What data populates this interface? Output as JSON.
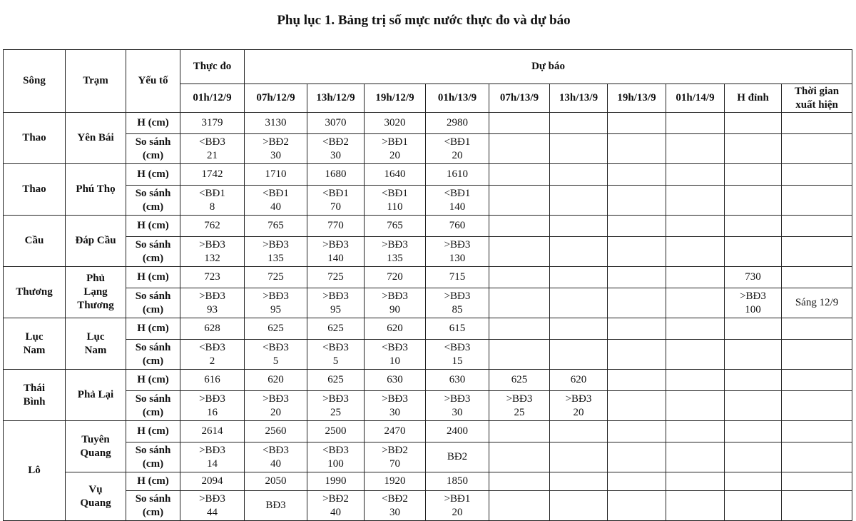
{
  "title": "Phụ lục 1. Bảng trị số mực nước thực đo và dự báo",
  "header": {
    "song": "Sông",
    "tram": "Trạm",
    "yeu_to": "Yếu tố",
    "thuc_do": "Thực đo",
    "du_bao": "Dự báo",
    "times": [
      "01h/12/9",
      "07h/12/9",
      "13h/12/9",
      "19h/12/9",
      "01h/13/9",
      "07h/13/9",
      "13h/13/9",
      "19h/13/9",
      "01h/14/9"
    ],
    "h_dinh": "H đỉnh",
    "thoi_gian": "Thời gian\nxuất hiện"
  },
  "labels": {
    "h": "H (cm)",
    "so_sanh": "So sánh\n(cm)"
  },
  "rows": [
    {
      "song": "Thao",
      "tram": "Yên Bái",
      "h": [
        "3179",
        "3130",
        "3070",
        "3020",
        "2980",
        "",
        "",
        "",
        ""
      ],
      "ss": [
        "<BĐ3\n21",
        ">BĐ2\n30",
        "<BĐ2\n30",
        ">BĐ1\n20",
        "<BĐ1\n20",
        "",
        "",
        "",
        ""
      ],
      "h_dinh": "",
      "ss_dinh": "",
      "thoi_gian": ""
    },
    {
      "song": "Thao",
      "tram": "Phú Thọ",
      "h": [
        "1742",
        "1710",
        "1680",
        "1640",
        "1610",
        "",
        "",
        "",
        ""
      ],
      "ss": [
        "<BĐ1\n8",
        "<BĐ1\n40",
        "<BĐ1\n70",
        "<BĐ1\n110",
        "<BĐ1\n140",
        "",
        "",
        "",
        ""
      ],
      "h_dinh": "",
      "ss_dinh": "",
      "thoi_gian": ""
    },
    {
      "song": "Cầu",
      "tram": "Đáp Cầu",
      "h": [
        "762",
        "765",
        "770",
        "765",
        "760",
        "",
        "",
        "",
        ""
      ],
      "ss": [
        ">BĐ3\n132",
        ">BĐ3\n135",
        ">BĐ3\n140",
        ">BĐ3\n135",
        ">BĐ3\n130",
        "",
        "",
        "",
        ""
      ],
      "h_dinh": "",
      "ss_dinh": "",
      "thoi_gian": ""
    },
    {
      "song": "Thương",
      "tram": "Phủ\nLạng\nThương",
      "h": [
        "723",
        "725",
        "725",
        "720",
        "715",
        "",
        "",
        "",
        ""
      ],
      "ss": [
        ">BĐ3\n93",
        ">BĐ3\n95",
        ">BĐ3\n95",
        ">BĐ3\n90",
        ">BĐ3\n85",
        "",
        "",
        "",
        ""
      ],
      "h_dinh": "730",
      "ss_dinh": ">BĐ3\n100",
      "thoi_gian": "Sáng 12/9"
    },
    {
      "song": "Lục\nNam",
      "tram": "Lục\nNam",
      "h": [
        "628",
        "625",
        "625",
        "620",
        "615",
        "",
        "",
        "",
        ""
      ],
      "ss": [
        "<BĐ3\n2",
        "<BĐ3\n5",
        "<BĐ3\n5",
        "<BĐ3\n10",
        "<BĐ3\n15",
        "",
        "",
        "",
        ""
      ],
      "h_dinh": "",
      "ss_dinh": "",
      "thoi_gian": ""
    },
    {
      "song": "Thái\nBình",
      "tram": "Phả Lại",
      "h": [
        "616",
        "620",
        "625",
        "630",
        "630",
        "625",
        "620",
        "",
        ""
      ],
      "ss": [
        ">BĐ3\n16",
        ">BĐ3\n20",
        ">BĐ3\n25",
        ">BĐ3\n30",
        ">BĐ3\n30",
        ">BĐ3\n25",
        ">BĐ3\n20",
        "",
        ""
      ],
      "h_dinh": "",
      "ss_dinh": "",
      "thoi_gian": ""
    },
    {
      "song": "Lô",
      "tram": "Tuyên\nQuang",
      "h": [
        "2614",
        "2560",
        "2500",
        "2470",
        "2400",
        "",
        "",
        "",
        ""
      ],
      "ss": [
        ">BĐ3\n14",
        "<BĐ3\n40",
        "<BĐ3\n100",
        ">BĐ2\n70",
        "BĐ2",
        "",
        "",
        "",
        ""
      ],
      "h_dinh": "",
      "ss_dinh": "",
      "thoi_gian": ""
    },
    {
      "song": "Lô",
      "tram": "Vụ\nQuang",
      "h": [
        "2094",
        "2050",
        "1990",
        "1920",
        "1850",
        "",
        "",
        "",
        ""
      ],
      "ss": [
        ">BĐ3\n44",
        "BĐ3",
        ">BĐ2\n40",
        "<BĐ2\n30",
        ">BĐ1\n20",
        "",
        "",
        "",
        ""
      ],
      "h_dinh": "",
      "ss_dinh": "",
      "thoi_gian": ""
    }
  ]
}
